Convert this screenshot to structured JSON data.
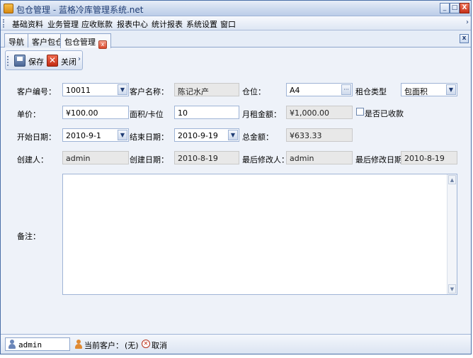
{
  "window": {
    "title": "包仓管理 - 蓝格冷库管理系统.net",
    "controls": {
      "minimize": "_",
      "restore": "□",
      "close": "X"
    }
  },
  "menu": {
    "items": [
      "基础资料",
      "业务管理",
      "应收账款",
      "报表中心",
      "统计报表",
      "系统设置",
      "窗口"
    ],
    "overflow": "›"
  },
  "tabs": {
    "items": [
      "导航",
      "客户包仓",
      "包仓管理"
    ],
    "active_close": "x",
    "strip_close": "x"
  },
  "toolbar": {
    "save": "保存",
    "close": "关闭",
    "overflow": "›"
  },
  "form": {
    "customer_no_label": "客户编号：",
    "customer_no": "10011",
    "customer_name_label": "客户名称：",
    "customer_name": "陈记水产",
    "location_label": "仓位：",
    "location": "A4",
    "location_btn": "···",
    "lease_type_label": "租仓类型",
    "lease_type": "包面积",
    "unit_price_label": "单价：",
    "unit_price": "¥100.00",
    "area_label": "面积/卡位",
    "area": "10",
    "monthly_rent_label": "月租金额：",
    "monthly_rent": "¥1,000.00",
    "collected_label": "是否已收款",
    "collected": false,
    "start_date_label": "开始日期：",
    "start_date": "2010-9-1",
    "end_date_label": "结束日期：",
    "end_date": "2010-9-19",
    "total_label": "总金额：",
    "total": "¥633.33",
    "creator_label": "创建人：",
    "creator": "admin",
    "created_date_label": "创建日期：",
    "created_date": "2010-8-19",
    "last_modifier_label": "最后修改人：",
    "last_modifier": "admin",
    "last_modified_date_label": "最后修改日期：",
    "last_modified_date": "2010-8-19",
    "notes_label": "备注：",
    "notes": ""
  },
  "status": {
    "user": "admin",
    "current_customer_label": "当前客户：",
    "current_customer": "(无)",
    "cancel": "取消"
  },
  "icons": {
    "app": "app-icon",
    "save": "save-icon",
    "close": "close-icon",
    "user": "person-icon",
    "customer": "person-icon",
    "cancel": "cancel-icon"
  }
}
